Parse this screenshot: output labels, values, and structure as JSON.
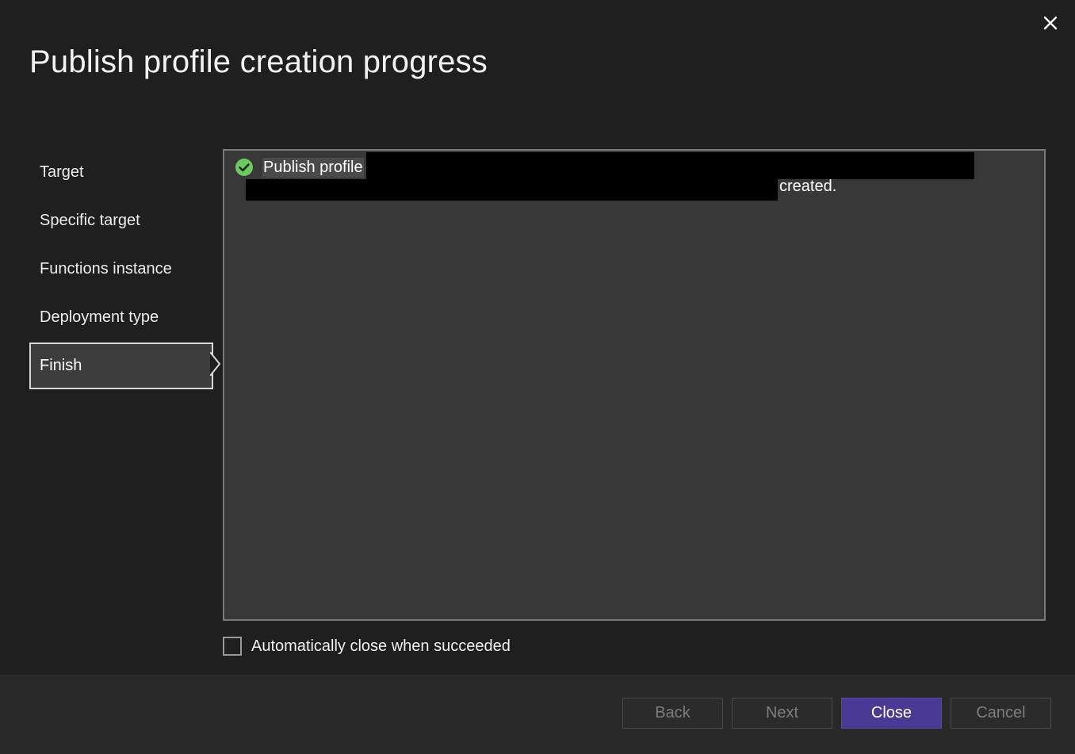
{
  "dialog": {
    "title": "Publish profile creation progress",
    "close_icon": "close-icon"
  },
  "steps": [
    {
      "label": "Target",
      "active": false
    },
    {
      "label": "Specific target",
      "active": false
    },
    {
      "label": "Functions instance",
      "active": false
    },
    {
      "label": "Deployment type",
      "active": false
    },
    {
      "label": "Finish",
      "active": true
    }
  ],
  "output": {
    "status_icon": "success-check-icon",
    "message_start": "Publish profile",
    "message_end": "created."
  },
  "auto_close": {
    "label": "Automatically close when succeeded",
    "checked": false
  },
  "buttons": {
    "back": "Back",
    "next": "Next",
    "close": "Close",
    "cancel": "Cancel"
  },
  "colors": {
    "background": "#1f1f1f",
    "footer": "#292929",
    "output_panel": "#383838",
    "primary_button": "#4b3a94",
    "success": "#6ccb5f"
  }
}
